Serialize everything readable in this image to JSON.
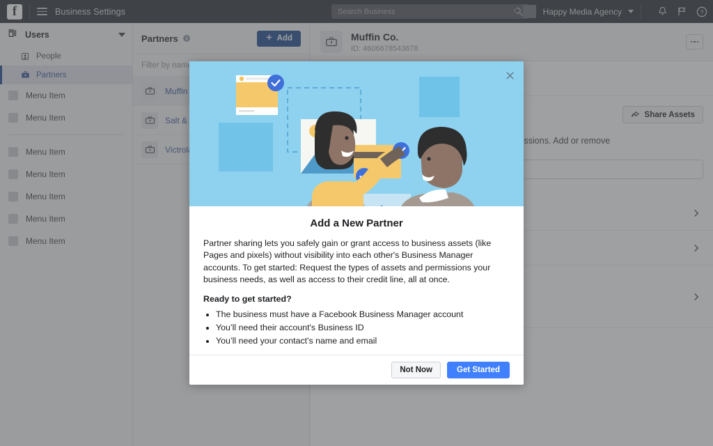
{
  "topbar": {
    "logo": "f",
    "menu_icon": "hamburger-icon",
    "title": "Business Settings",
    "search": {
      "value": "",
      "placeholder": "Search Business",
      "icon": "search-icon"
    },
    "account_name": "Happy Media Agency",
    "icons": [
      "bell-icon",
      "flag-icon",
      "help-icon"
    ]
  },
  "sidebar": {
    "header": {
      "label": "Users",
      "icon": "users-icon",
      "caret": "chevron-down-icon"
    },
    "items": [
      {
        "label": "People",
        "icon": "person-icon",
        "active": false
      },
      {
        "label": "Partners",
        "icon": "briefcase-icon",
        "active": true
      }
    ],
    "menu_items_top": [
      {
        "label": "Menu Item"
      },
      {
        "label": "Menu Item"
      }
    ],
    "menu_items_bottom": [
      {
        "label": "Menu Item"
      },
      {
        "label": "Menu Item"
      },
      {
        "label": "Menu Item"
      },
      {
        "label": "Menu Item"
      },
      {
        "label": "Menu Item"
      }
    ]
  },
  "partners_column": {
    "title": "Partners",
    "info_icon": "info-icon",
    "add_label": "Add",
    "add_icon": "plus-icon",
    "filter": {
      "value": "",
      "placeholder": "Filter by name"
    },
    "rows": [
      {
        "name": "Muffin Co.",
        "icon": "briefcase-icon",
        "selected": true
      },
      {
        "name": "Salt & Straw",
        "icon": "briefcase-icon",
        "selected": false
      },
      {
        "name": "Victrola Coffee",
        "icon": "briefcase-icon",
        "selected": false
      }
    ]
  },
  "main": {
    "icon": "briefcase-icon",
    "title": "Muffin Co.",
    "subtitle": "ID: 4606678543678",
    "more_icon": "ellipsis-icon",
    "share_assets_label": "Share Assets",
    "share_icon": "share-icon",
    "description": "Assign assets to this partner and manage their permissions. Add or remove",
    "chevron_icon": "chevron-right-icon",
    "rows": [
      {
        "chevron": "chevron-right-icon"
      },
      {
        "chevron": "chevron-right-icon"
      },
      {
        "chevron": "chevron-right-icon"
      }
    ]
  },
  "modal": {
    "close_icon": "close-icon",
    "hero_image": "partner-sharing-illustration",
    "title": "Add a New Partner",
    "paragraph": "Partner sharing lets you safely gain or grant access to business assets (like Pages and pixels) without visibility into each other's Business Manager accounts. To get started: Request the types of assets and permissions your business needs, as well as access to their credit line, all at once.",
    "subheading": "Ready to get started?",
    "bullets": [
      "The business must have a Facebook Business Manager account",
      "You’ll need their account's Business ID",
      "You’ll need your contact's name and email"
    ],
    "secondary_button": "Not Now",
    "primary_button": "Get Started"
  },
  "colors": {
    "topbar_bg": "#2c2f33",
    "accent_blue": "#1d4b8f",
    "primary_button": "#4080ff",
    "link_blue": "#3b5998",
    "hero_bg": "#8ed2ef",
    "overlay": "rgba(80,82,86,0.55)"
  }
}
